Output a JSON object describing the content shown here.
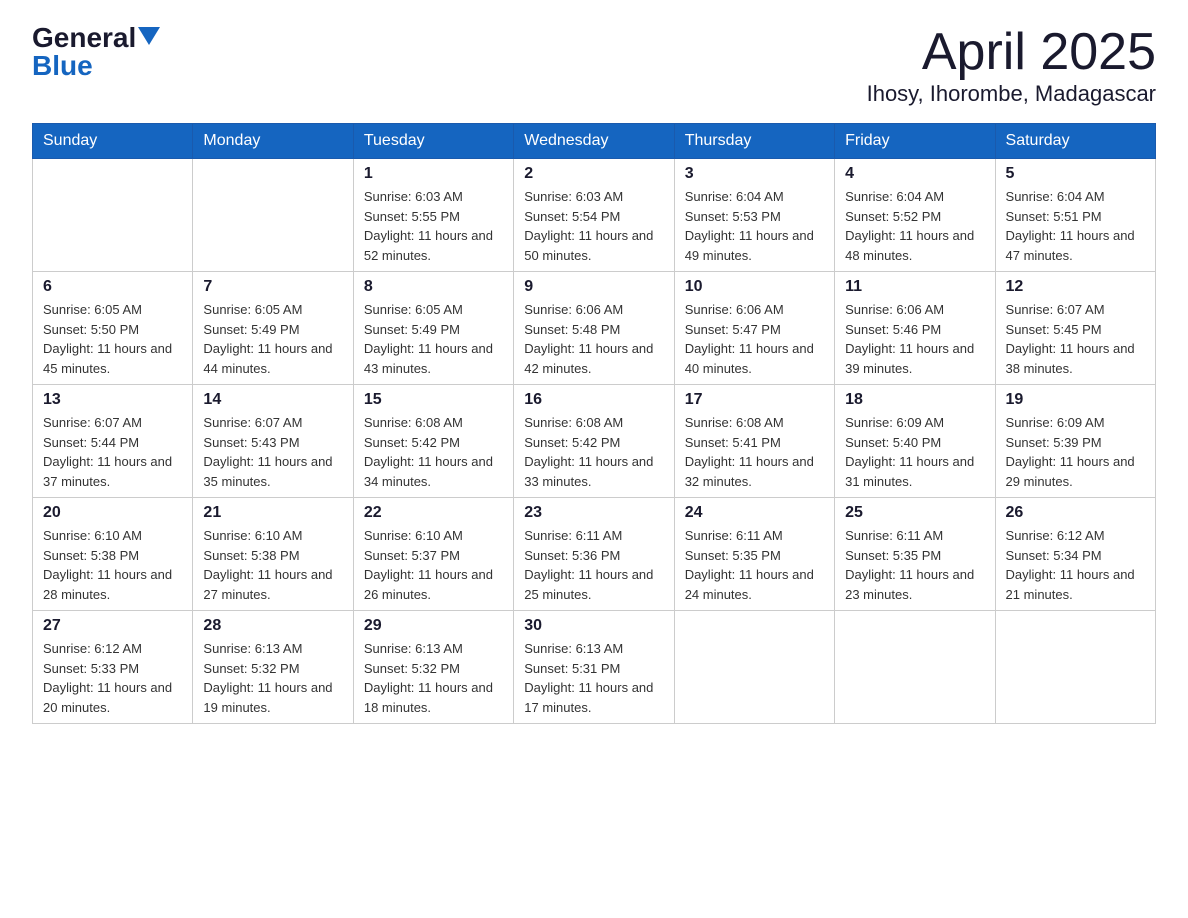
{
  "logo": {
    "general": "General",
    "blue": "Blue"
  },
  "title": "April 2025",
  "subtitle": "Ihosy, Ihorombe, Madagascar",
  "days_header": [
    "Sunday",
    "Monday",
    "Tuesday",
    "Wednesday",
    "Thursday",
    "Friday",
    "Saturday"
  ],
  "weeks": [
    [
      {
        "day": "",
        "info": ""
      },
      {
        "day": "",
        "info": ""
      },
      {
        "day": "1",
        "info": "Sunrise: 6:03 AM\nSunset: 5:55 PM\nDaylight: 11 hours and 52 minutes."
      },
      {
        "day": "2",
        "info": "Sunrise: 6:03 AM\nSunset: 5:54 PM\nDaylight: 11 hours and 50 minutes."
      },
      {
        "day": "3",
        "info": "Sunrise: 6:04 AM\nSunset: 5:53 PM\nDaylight: 11 hours and 49 minutes."
      },
      {
        "day": "4",
        "info": "Sunrise: 6:04 AM\nSunset: 5:52 PM\nDaylight: 11 hours and 48 minutes."
      },
      {
        "day": "5",
        "info": "Sunrise: 6:04 AM\nSunset: 5:51 PM\nDaylight: 11 hours and 47 minutes."
      }
    ],
    [
      {
        "day": "6",
        "info": "Sunrise: 6:05 AM\nSunset: 5:50 PM\nDaylight: 11 hours and 45 minutes."
      },
      {
        "day": "7",
        "info": "Sunrise: 6:05 AM\nSunset: 5:49 PM\nDaylight: 11 hours and 44 minutes."
      },
      {
        "day": "8",
        "info": "Sunrise: 6:05 AM\nSunset: 5:49 PM\nDaylight: 11 hours and 43 minutes."
      },
      {
        "day": "9",
        "info": "Sunrise: 6:06 AM\nSunset: 5:48 PM\nDaylight: 11 hours and 42 minutes."
      },
      {
        "day": "10",
        "info": "Sunrise: 6:06 AM\nSunset: 5:47 PM\nDaylight: 11 hours and 40 minutes."
      },
      {
        "day": "11",
        "info": "Sunrise: 6:06 AM\nSunset: 5:46 PM\nDaylight: 11 hours and 39 minutes."
      },
      {
        "day": "12",
        "info": "Sunrise: 6:07 AM\nSunset: 5:45 PM\nDaylight: 11 hours and 38 minutes."
      }
    ],
    [
      {
        "day": "13",
        "info": "Sunrise: 6:07 AM\nSunset: 5:44 PM\nDaylight: 11 hours and 37 minutes."
      },
      {
        "day": "14",
        "info": "Sunrise: 6:07 AM\nSunset: 5:43 PM\nDaylight: 11 hours and 35 minutes."
      },
      {
        "day": "15",
        "info": "Sunrise: 6:08 AM\nSunset: 5:42 PM\nDaylight: 11 hours and 34 minutes."
      },
      {
        "day": "16",
        "info": "Sunrise: 6:08 AM\nSunset: 5:42 PM\nDaylight: 11 hours and 33 minutes."
      },
      {
        "day": "17",
        "info": "Sunrise: 6:08 AM\nSunset: 5:41 PM\nDaylight: 11 hours and 32 minutes."
      },
      {
        "day": "18",
        "info": "Sunrise: 6:09 AM\nSunset: 5:40 PM\nDaylight: 11 hours and 31 minutes."
      },
      {
        "day": "19",
        "info": "Sunrise: 6:09 AM\nSunset: 5:39 PM\nDaylight: 11 hours and 29 minutes."
      }
    ],
    [
      {
        "day": "20",
        "info": "Sunrise: 6:10 AM\nSunset: 5:38 PM\nDaylight: 11 hours and 28 minutes."
      },
      {
        "day": "21",
        "info": "Sunrise: 6:10 AM\nSunset: 5:38 PM\nDaylight: 11 hours and 27 minutes."
      },
      {
        "day": "22",
        "info": "Sunrise: 6:10 AM\nSunset: 5:37 PM\nDaylight: 11 hours and 26 minutes."
      },
      {
        "day": "23",
        "info": "Sunrise: 6:11 AM\nSunset: 5:36 PM\nDaylight: 11 hours and 25 minutes."
      },
      {
        "day": "24",
        "info": "Sunrise: 6:11 AM\nSunset: 5:35 PM\nDaylight: 11 hours and 24 minutes."
      },
      {
        "day": "25",
        "info": "Sunrise: 6:11 AM\nSunset: 5:35 PM\nDaylight: 11 hours and 23 minutes."
      },
      {
        "day": "26",
        "info": "Sunrise: 6:12 AM\nSunset: 5:34 PM\nDaylight: 11 hours and 21 minutes."
      }
    ],
    [
      {
        "day": "27",
        "info": "Sunrise: 6:12 AM\nSunset: 5:33 PM\nDaylight: 11 hours and 20 minutes."
      },
      {
        "day": "28",
        "info": "Sunrise: 6:13 AM\nSunset: 5:32 PM\nDaylight: 11 hours and 19 minutes."
      },
      {
        "day": "29",
        "info": "Sunrise: 6:13 AM\nSunset: 5:32 PM\nDaylight: 11 hours and 18 minutes."
      },
      {
        "day": "30",
        "info": "Sunrise: 6:13 AM\nSunset: 5:31 PM\nDaylight: 11 hours and 17 minutes."
      },
      {
        "day": "",
        "info": ""
      },
      {
        "day": "",
        "info": ""
      },
      {
        "day": "",
        "info": ""
      }
    ]
  ]
}
